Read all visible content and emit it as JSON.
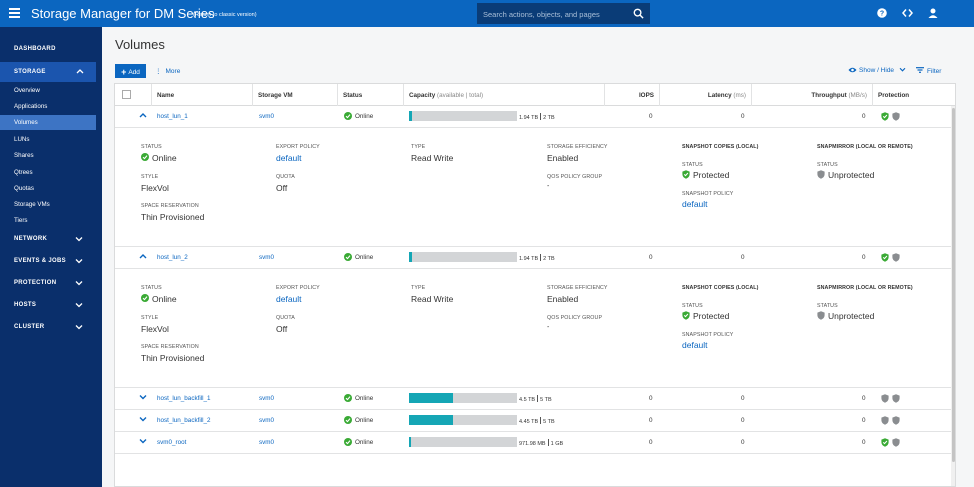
{
  "app": {
    "title": "Storage Manager for DM Series",
    "classic_link": "(Return to classic version)",
    "search_placeholder": "Search actions, objects, and pages"
  },
  "icons": {
    "menu": "hamburger-icon",
    "search": "search-icon",
    "help": "help-icon",
    "code": "code-icon",
    "user": "user-icon"
  },
  "sidebar": {
    "dashboard": "DASHBOARD",
    "storage": "STORAGE",
    "storage_items": [
      "Overview",
      "Applications",
      "Volumes",
      "LUNs",
      "Shares",
      "Qtrees",
      "Quotas",
      "Storage VMs",
      "Tiers"
    ],
    "active_item": "Volumes",
    "groups": [
      "NETWORK",
      "EVENTS & JOBS",
      "PROTECTION",
      "HOSTS",
      "CLUSTER"
    ]
  },
  "page": {
    "title": "Volumes",
    "add_label": "Add",
    "more_label": "More",
    "show_hide_label": "Show / Hide",
    "filter_label": "Filter"
  },
  "table": {
    "headers": {
      "name": "Name",
      "svm": "Storage VM",
      "status": "Status",
      "capacity": "Capacity",
      "capacity_sub": "(available | total)",
      "iops": "IOPS",
      "latency": "Latency",
      "latency_sub": "(ms)",
      "throughput": "Throughput",
      "throughput_sub": "(MB/s)",
      "protection": "Protection"
    },
    "rows": [
      {
        "name": "host_lun_1",
        "svm": "svm0",
        "status": "Online",
        "available": "1.94 TB",
        "total": "2 TB",
        "used_fraction": 0.03,
        "iops": "0",
        "latency": "0",
        "throughput": "0",
        "expanded": true,
        "snapshot_protected": true
      },
      {
        "name": "host_lun_2",
        "svm": "svm0",
        "status": "Online",
        "available": "1.94 TB",
        "total": "2 TB",
        "used_fraction": 0.03,
        "iops": "0",
        "latency": "0",
        "throughput": "0",
        "expanded": true,
        "snapshot_protected": true
      },
      {
        "name": "host_lun_backfill_1",
        "svm": "svm0",
        "status": "Online",
        "available": "4.5 TB",
        "total": "5 TB",
        "used_fraction": 0.41,
        "iops": "0",
        "latency": "0",
        "throughput": "0",
        "expanded": false,
        "snapshot_protected": false
      },
      {
        "name": "host_lun_backfill_2",
        "svm": "svm0",
        "status": "Online",
        "available": "4.45 TB",
        "total": "5 TB",
        "used_fraction": 0.41,
        "iops": "0",
        "latency": "0",
        "throughput": "0",
        "expanded": false,
        "snapshot_protected": false
      },
      {
        "name": "svm0_root",
        "svm": "svm0",
        "status": "Online",
        "available": "971.98 MB",
        "total": "1 GB",
        "used_fraction": 0.0,
        "iops": "0",
        "latency": "0",
        "throughput": "0",
        "expanded": false,
        "snapshot_protected": true
      }
    ]
  },
  "details": [
    {
      "status_label": "STATUS",
      "status_value": "Online",
      "style_label": "STYLE",
      "style_value": "FlexVol",
      "reservation_label": "SPACE RESERVATION",
      "reservation_value": "Thin Provisioned",
      "export_label": "EXPORT POLICY",
      "export_value": "default",
      "quota_label": "QUOTA",
      "quota_value": "Off",
      "type_label": "TYPE",
      "type_value": "Read Write",
      "efficiency_label": "STORAGE EFFICIENCY",
      "efficiency_value": "Enabled",
      "qos_label": "QOS POLICY GROUP",
      "qos_value": "-",
      "snapshot_heading": "SNAPSHOT COPIES (LOCAL)",
      "snapshot_status_label": "STATUS",
      "snapshot_status_value": "Protected",
      "snapshot_policy_label": "SNAPSHOT POLICY",
      "snapshot_policy_value": "default",
      "snapmirror_heading": "SNAPMIRROR (LOCAL OR REMOTE)",
      "snapmirror_status_label": "STATUS",
      "snapmirror_status_value": "Unprotected"
    },
    {
      "status_label": "STATUS",
      "status_value": "Online",
      "style_label": "STYLE",
      "style_value": "FlexVol",
      "reservation_label": "SPACE RESERVATION",
      "reservation_value": "Thin Provisioned",
      "export_label": "EXPORT POLICY",
      "export_value": "default",
      "quota_label": "QUOTA",
      "quota_value": "Off",
      "type_label": "TYPE",
      "type_value": "Read Write",
      "efficiency_label": "STORAGE EFFICIENCY",
      "efficiency_value": "Enabled",
      "qos_label": "QOS POLICY GROUP",
      "qos_value": "-",
      "snapshot_heading": "SNAPSHOT COPIES (LOCAL)",
      "snapshot_status_label": "STATUS",
      "snapshot_status_value": "Protected",
      "snapshot_policy_label": "SNAPSHOT POLICY",
      "snapshot_policy_value": "default",
      "snapmirror_heading": "SNAPMIRROR (LOCAL OR REMOTE)",
      "snapmirror_status_label": "STATUS",
      "snapmirror_status_value": "Unprotected"
    }
  ],
  "colors": {
    "brand_blue": "#0b66c0",
    "sidebar": "#0a2f6b",
    "online_green": "#3aaa35",
    "capacity_fill": "#15a6b5",
    "shield_gray": "#8a8d90"
  }
}
